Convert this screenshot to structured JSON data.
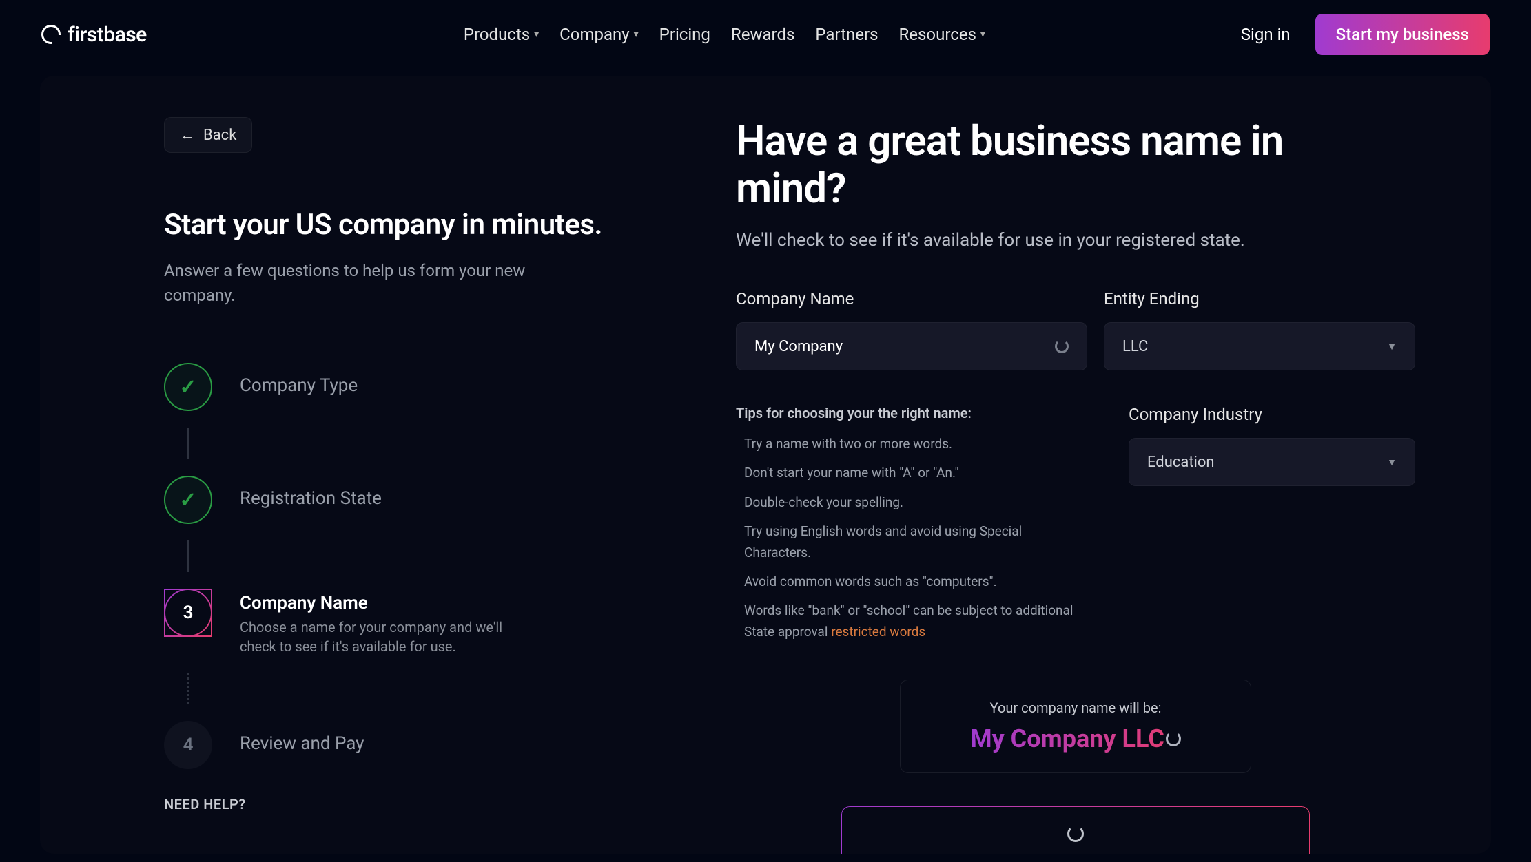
{
  "brand": "firstbase",
  "nav": {
    "items": [
      {
        "label": "Products",
        "dropdown": true
      },
      {
        "label": "Company",
        "dropdown": true
      },
      {
        "label": "Pricing",
        "dropdown": false
      },
      {
        "label": "Rewards",
        "dropdown": false
      },
      {
        "label": "Partners",
        "dropdown": false
      },
      {
        "label": "Resources",
        "dropdown": true
      }
    ],
    "signin": "Sign in",
    "cta": "Start my business"
  },
  "left": {
    "back": "Back",
    "title": "Start your US company in minutes.",
    "subtitle": "Answer a few questions to help us form your new company.",
    "steps": [
      {
        "label": "Company Type",
        "status": "done"
      },
      {
        "label": "Registration State",
        "status": "done"
      },
      {
        "label": "Company Name",
        "status": "current",
        "num": "3",
        "desc": "Choose a name for your company and we'll check to see if it's available for use."
      },
      {
        "label": "Review and Pay",
        "status": "future",
        "num": "4"
      }
    ],
    "need_help": "NEED HELP?"
  },
  "right": {
    "title": "Have a great business name in mind?",
    "subtitle": "We'll check to see if it's available for use in your registered state.",
    "company_name_label": "Company Name",
    "company_name_value": "My Company",
    "entity_ending_label": "Entity Ending",
    "entity_ending_value": "LLC",
    "industry_label": "Company Industry",
    "industry_value": "Education",
    "tips_title": "Tips for choosing your the right name:",
    "tips": [
      "Try a name with two or more words.",
      "Don't start your name with \"A\" or \"An.\"",
      "Double-check your spelling.",
      "Try using English words and avoid using Special Characters.",
      "Avoid common words such as \"computers\"."
    ],
    "tips_last_a": "Words like \"bank\" or \"school\" can be subject to additional State approval ",
    "tips_last_b": "restricted words",
    "preview_label": "Your company name will be:",
    "preview_name": "My Company LLC"
  }
}
